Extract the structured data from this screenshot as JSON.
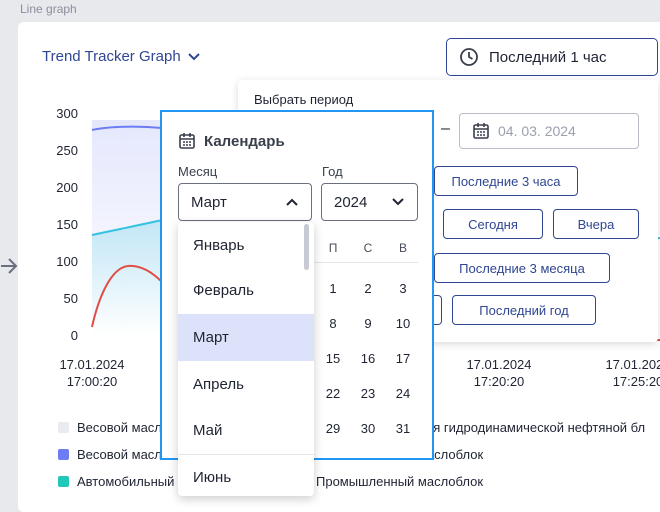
{
  "page": {
    "label": "Line graph"
  },
  "header": {
    "graph_title": "Trend Tracker Graph",
    "period_button": "Последний 1 час"
  },
  "colors": {
    "accent": "#2f4693",
    "focus": "#2196f3",
    "series_blue": "#6e7cf3",
    "series_cyan": "#34c3df",
    "series_red": "#e04e47",
    "series_grey": "#e9ebf0"
  },
  "chart_data": {
    "type": "line",
    "y_ticks": [
      "300",
      "250",
      "200",
      "150",
      "100",
      "50",
      "0"
    ],
    "ylim": [
      0,
      300
    ],
    "x_ticks": [
      {
        "date": "17.01.2024",
        "time": "17:00:20"
      },
      {
        "date": "17.01.2024",
        "time": "17:20:20"
      },
      {
        "date": "17.01.2024",
        "time": "17:25:20"
      }
    ],
    "series": [
      {
        "values": [
          290,
          292,
          291,
          290,
          292
        ]
      },
      {
        "values": [
          135,
          145,
          152,
          160,
          155
        ]
      },
      {
        "values": [
          10,
          85,
          95,
          70,
          50
        ]
      }
    ],
    "legend": [
      {
        "label": "Весовой масл",
        "color": "#e9ebf0"
      },
      {
        "label": "Весовой масл",
        "color": "#6e7cf3"
      },
      {
        "label": "Автомобильный",
        "color": "#1fc8b8"
      }
    ],
    "legend_right": [
      "ия гидродинамической нефтяной бл",
      "маслоблок",
      "Промышленный маслоблок"
    ]
  },
  "period_panel": {
    "label": "Выбрать период",
    "date_to": "04. 03. 2024",
    "buttons": {
      "last3h": "Последние 3 часа",
      "today": "Сегодня",
      "yesterday": "Вчера",
      "last3m": "Последние 3 месяца",
      "last_year": "Последний год"
    }
  },
  "calendar": {
    "title": "Календарь",
    "month_label": "Месяц",
    "year_label": "Год",
    "month_value": "Март",
    "year_value": "2024",
    "weekdays": [
      "П",
      "С",
      "В"
    ],
    "days": [
      [
        "1",
        "2",
        "3"
      ],
      [
        "8",
        "9",
        "10"
      ],
      [
        "15",
        "16",
        "17"
      ],
      [
        "22",
        "23",
        "24"
      ],
      [
        "29",
        "30",
        "31"
      ]
    ],
    "months": [
      "Январь",
      "Февраль",
      "Март",
      "Апрель",
      "Май",
      "Июнь"
    ],
    "selected_month_index": 2
  }
}
